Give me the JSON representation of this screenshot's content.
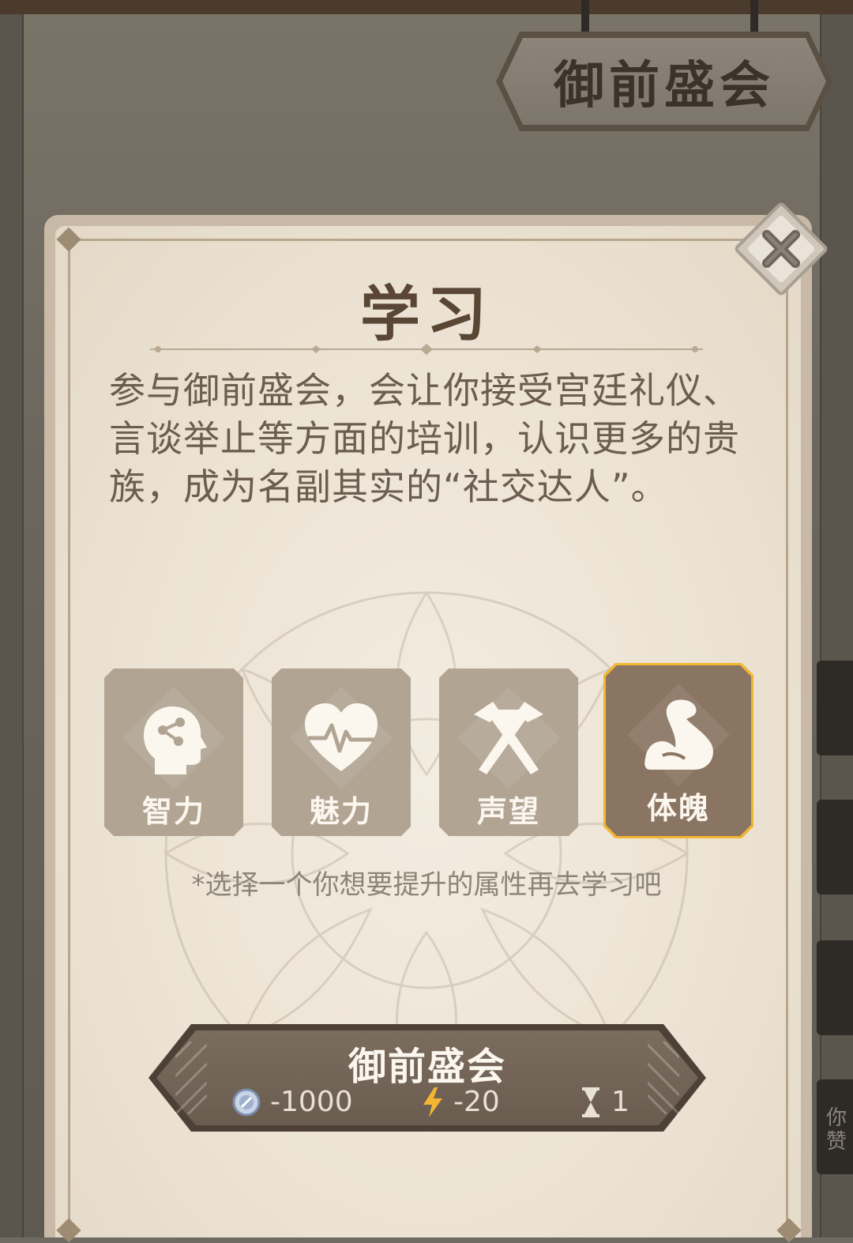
{
  "sign": {
    "title": "御前盛会"
  },
  "background": {
    "side_tab_text": "你赞"
  },
  "dialog": {
    "title": "学习",
    "description": "参与御前盛会，会让你接受宫廷礼仪、言谈举止等方面的培训，认识更多的贵族，成为名副其实的“社交达人”。",
    "attributes": [
      {
        "label": "智力",
        "icon": "brain-head-icon",
        "selected": false
      },
      {
        "label": "魅力",
        "icon": "heartbeat-icon",
        "selected": false
      },
      {
        "label": "声望",
        "icon": "crossed-hammers-icon",
        "selected": false
      },
      {
        "label": "体魄",
        "icon": "flexed-arm-icon",
        "selected": true
      }
    ],
    "hint": "*选择一个你想要提升的属性再去学习吧",
    "action": {
      "label": "御前盛会",
      "costs": [
        {
          "icon": "silver-coin-icon",
          "value": "-1000"
        },
        {
          "icon": "lightning-energy-icon",
          "value": "-20"
        },
        {
          "icon": "hourglass-icon",
          "value": "1"
        }
      ]
    }
  },
  "colors": {
    "selected_border": "#f2b632",
    "tile_bg": "#b1a493",
    "selected_tile_bg": "#8a7562"
  }
}
